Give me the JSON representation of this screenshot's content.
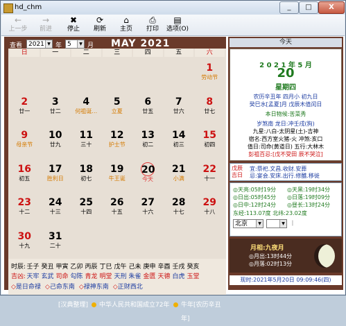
{
  "window": {
    "title": "hd_chm",
    "buttons": {
      "minimize": "_",
      "maximize": "□",
      "close": "X"
    }
  },
  "toolbar": [
    {
      "label": "上一步",
      "icon": "←",
      "enabled": false
    },
    {
      "label": "前进",
      "icon": "→",
      "enabled": false
    },
    {
      "label": "停止",
      "icon": "✖",
      "enabled": true
    },
    {
      "label": "刷新",
      "icon": "⟳",
      "enabled": true
    },
    {
      "label": "主页",
      "icon": "⌂",
      "enabled": true
    },
    {
      "label": "打印",
      "icon": "⎙",
      "enabled": true
    },
    {
      "label": "选项(O)",
      "icon": "▤",
      "enabled": true
    }
  ],
  "header": {
    "query_label": "查看",
    "year_value": "2021",
    "year_unit": "年",
    "month_value": "5",
    "month_unit": "月",
    "month_title": "MAY 2021"
  },
  "weekdays": [
    "日",
    "一",
    "二",
    "三",
    "四",
    "五",
    "六"
  ],
  "calendar": [
    {
      "col": 6,
      "row": 0,
      "day": "1",
      "sub": "劳动节",
      "type": "holiday"
    },
    {
      "col": 0,
      "row": 1,
      "day": "2",
      "sub": "廿一",
      "type": "weekend"
    },
    {
      "col": 1,
      "row": 1,
      "day": "3",
      "sub": "廿二",
      "type": "normal"
    },
    {
      "col": 2,
      "row": 1,
      "day": "4",
      "sub": "何祖诞…",
      "type": "event"
    },
    {
      "col": 3,
      "row": 1,
      "day": "5",
      "sub": "立夏",
      "type": "term"
    },
    {
      "col": 4,
      "row": 1,
      "day": "6",
      "sub": "廿五",
      "type": "normal"
    },
    {
      "col": 5,
      "row": 1,
      "day": "7",
      "sub": "廿六",
      "type": "normal"
    },
    {
      "col": 6,
      "row": 1,
      "day": "8",
      "sub": "廿七",
      "type": "weekend"
    },
    {
      "col": 0,
      "row": 2,
      "day": "9",
      "sub": "母亲节",
      "type": "holidayw"
    },
    {
      "col": 1,
      "row": 2,
      "day": "10",
      "sub": "廿九",
      "type": "normal"
    },
    {
      "col": 2,
      "row": 2,
      "day": "11",
      "sub": "三十",
      "type": "normal"
    },
    {
      "col": 3,
      "row": 2,
      "day": "12",
      "sub": "护士节",
      "type": "term"
    },
    {
      "col": 4,
      "row": 2,
      "day": "13",
      "sub": "初二",
      "type": "normal"
    },
    {
      "col": 5,
      "row": 2,
      "day": "14",
      "sub": "初三",
      "type": "normal"
    },
    {
      "col": 6,
      "row": 2,
      "day": "15",
      "sub": "初四",
      "type": "weekend"
    },
    {
      "col": 0,
      "row": 3,
      "day": "16",
      "sub": "初五",
      "type": "weekend"
    },
    {
      "col": 1,
      "row": 3,
      "day": "17",
      "sub": "胜利日",
      "type": "term"
    },
    {
      "col": 2,
      "row": 3,
      "day": "18",
      "sub": "初七",
      "type": "normal"
    },
    {
      "col": 3,
      "row": 3,
      "day": "19",
      "sub": "牛王诞",
      "type": "term"
    },
    {
      "col": 4,
      "row": 3,
      "day": "20",
      "sub": "今天",
      "type": "today"
    },
    {
      "col": 5,
      "row": 3,
      "day": "21",
      "sub": "小满",
      "type": "term"
    },
    {
      "col": 6,
      "row": 3,
      "day": "22",
      "sub": "十一",
      "type": "weekend"
    },
    {
      "col": 0,
      "row": 4,
      "day": "23",
      "sub": "十二",
      "type": "weekend"
    },
    {
      "col": 1,
      "row": 4,
      "day": "24",
      "sub": "十三",
      "type": "normal"
    },
    {
      "col": 2,
      "row": 4,
      "day": "25",
      "sub": "十四",
      "type": "normal"
    },
    {
      "col": 3,
      "row": 4,
      "day": "26",
      "sub": "十五",
      "type": "normal"
    },
    {
      "col": 4,
      "row": 4,
      "day": "27",
      "sub": "十六",
      "type": "normal"
    },
    {
      "col": 5,
      "row": 4,
      "day": "28",
      "sub": "十七",
      "type": "normal"
    },
    {
      "col": 6,
      "row": 4,
      "day": "29",
      "sub": "十八",
      "type": "weekend"
    },
    {
      "col": 0,
      "row": 5,
      "day": "30",
      "sub": "十九",
      "type": "weekend"
    },
    {
      "col": 1,
      "row": 5,
      "day": "31",
      "sub": "二十",
      "type": "normal"
    }
  ],
  "shichen": {
    "label": "时辰:",
    "items": [
      "壬子",
      "癸丑",
      "甲寅",
      "乙卯",
      "丙辰",
      "丁巳",
      "戊午",
      "己未",
      "庚申",
      "辛酉",
      "壬戌",
      "癸亥"
    ]
  },
  "jixiong": {
    "label": "吉凶:",
    "items": [
      "天牢",
      "玄武",
      "司命",
      "勾陈",
      "青龙",
      "明堂",
      "天刑",
      "朱雀",
      "金匮",
      "天德",
      "白虎",
      "玉堂"
    ]
  },
  "shen": [
    "是日命禄",
    "己命东南",
    "禄神东南",
    "正财西北"
  ],
  "footer": {
    "left": "[汉典整理]",
    "mid": "中华人民共和国成立72年",
    "right": "牛年[农历辛丑年]"
  },
  "side": {
    "today_tab": "今天",
    "year_month": "2 0 2 1 年 5 月",
    "day": "20",
    "weekday": "星期四",
    "lunar1": "农历辛丑年  四月小  初九日",
    "lunar2": "癸巳水[孟夏]月  戊辰木值闰日",
    "wuhou": "本日物候:苦菜秀",
    "stars": "岁煞南  龙日:冲壬戌(狗)",
    "xing": "九星:八白-太阴星(土)-吉神",
    "xiu": "宿名:西方室火猪-火  冲煞:亥口",
    "zhishen": "值日:司命(黄道日)  五行:大林木",
    "pengzu": "彭祖百忌:[戊不受田  辰不哭泣]",
    "yiji_label": "戊辰  吉日",
    "yi": "宜:祭祀.文昌.收财.安葬",
    "ji": "忌:宴会.安床.出行.修醮.移徙",
    "sun": [
      "天亮:05时19分",
      "天黑:19时34分",
      "日出:05时45分",
      "日落:19时09分",
      "日中:12时24分",
      "昼长:13时24分"
    ],
    "coords": "东经:113.07度  北纬:23.02度",
    "city": "北京",
    "moon_title": "月相:九夜月",
    "moonrise": "月出:13时44分",
    "moonset": "月落:02时13分",
    "now": "现时:2021年5月20日  09:09:46(四)"
  },
  "colors": {
    "frame": "#6a3a2a",
    "red": "#cc1111",
    "orange": "#d47a00",
    "green": "#1f7a1f",
    "blue": "#1a3aa0",
    "today": "#e23a3a"
  }
}
